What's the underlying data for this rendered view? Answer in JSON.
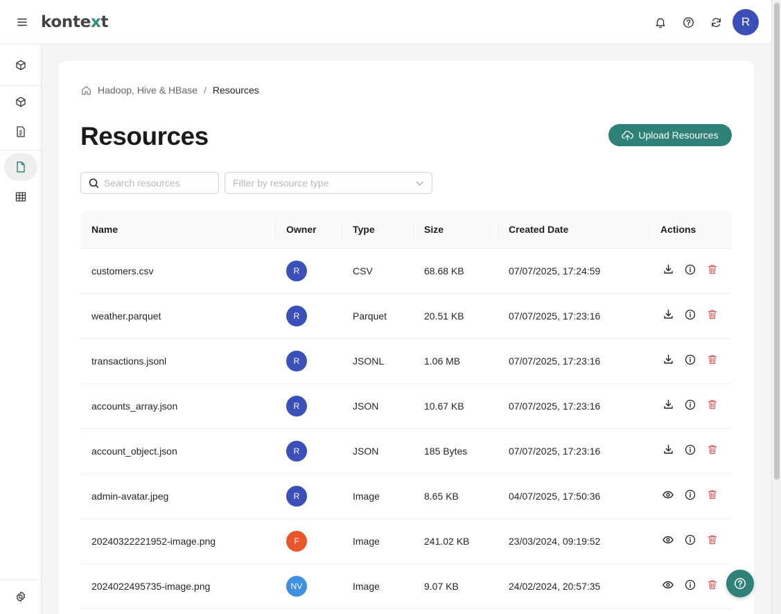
{
  "app": {
    "logo_part1": "konte",
    "logo_part2": "x",
    "logo_part3": "t"
  },
  "topbar": {
    "user_initial": "R"
  },
  "breadcrumb": {
    "parent": "Hadoop, Hive & HBase",
    "separator": "/",
    "current": "Resources"
  },
  "page": {
    "title": "Resources",
    "upload_label": "Upload Resources",
    "search_placeholder": "Search resources",
    "filter_placeholder": "Filter by resource type"
  },
  "table": {
    "headers": {
      "name": "Name",
      "owner": "Owner",
      "type": "Type",
      "size": "Size",
      "created": "Created Date",
      "actions": "Actions"
    },
    "rows": [
      {
        "name": "customers.csv",
        "owner": "R",
        "owner_color": "#3b4fb8",
        "type": "CSV",
        "size": "68.68 KB",
        "created": "07/07/2025, 17:24:59",
        "primary_action": "download"
      },
      {
        "name": "weather.parquet",
        "owner": "R",
        "owner_color": "#3b4fb8",
        "type": "Parquet",
        "size": "20.51 KB",
        "created": "07/07/2025, 17:23:16",
        "primary_action": "download"
      },
      {
        "name": "transactions.jsonl",
        "owner": "R",
        "owner_color": "#3b4fb8",
        "type": "JSONL",
        "size": "1.06 MB",
        "created": "07/07/2025, 17:23:16",
        "primary_action": "download"
      },
      {
        "name": "accounts_array.json",
        "owner": "R",
        "owner_color": "#3b4fb8",
        "type": "JSON",
        "size": "10.67 KB",
        "created": "07/07/2025, 17:23:16",
        "primary_action": "download"
      },
      {
        "name": "account_object.json",
        "owner": "R",
        "owner_color": "#3b4fb8",
        "type": "JSON",
        "size": "185 Bytes",
        "created": "07/07/2025, 17:23:16",
        "primary_action": "download"
      },
      {
        "name": "admin-avatar.jpeg",
        "owner": "R",
        "owner_color": "#3b4fb8",
        "type": "Image",
        "size": "8.65 KB",
        "created": "04/07/2025, 17:50:36",
        "primary_action": "view"
      },
      {
        "name": "20240322221952-image.png",
        "owner": "F",
        "owner_color": "#e8562a",
        "type": "Image",
        "size": "241.02 KB",
        "created": "23/03/2024, 09:19:52",
        "primary_action": "view"
      },
      {
        "name": "2024022495735-image.png",
        "owner": "NV",
        "owner_color": "#3d8fe0",
        "type": "Image",
        "size": "9.07 KB",
        "created": "24/02/2024, 20:57:35",
        "primary_action": "view"
      }
    ]
  },
  "colors": {
    "accent": "#2e8177",
    "avatar": "#3b4fb8",
    "delete": "#e05a5a"
  },
  "icons": {
    "topbar": [
      "menu-icon",
      "bell-icon",
      "help-icon",
      "refresh-icon"
    ],
    "sidebar": [
      "cube-icon",
      "cube-icon",
      "document-icon",
      "file-icon",
      "table-icon",
      "gear-icon"
    ]
  }
}
